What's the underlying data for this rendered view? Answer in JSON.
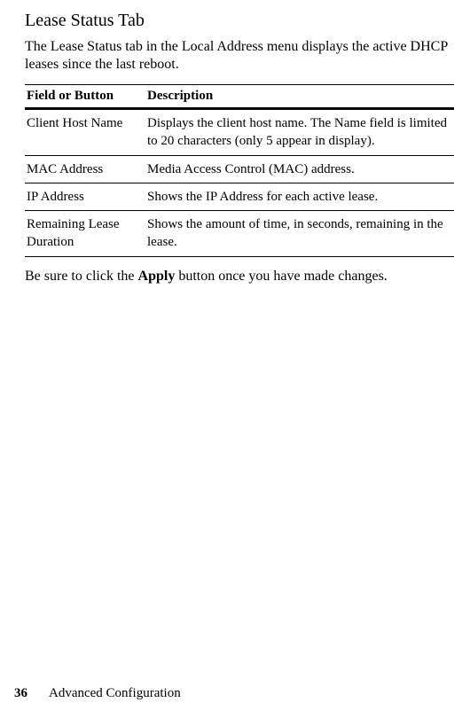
{
  "section": {
    "title": "Lease Status Tab",
    "intro": "The Lease Status tab in the Local Address menu displays the active DHCP leases since the last reboot."
  },
  "table": {
    "headers": {
      "field": "Field or Button",
      "description": "Description"
    },
    "rows": [
      {
        "field": "Client Host Name",
        "description": "Displays the client host name. The Name field is limited to 20 characters (only 5 appear in display)."
      },
      {
        "field": "MAC Address",
        "description": "Media Access Control (MAC) address."
      },
      {
        "field": "IP Address",
        "description": "Shows the IP Address for each active lease."
      },
      {
        "field": "Remaining Lease Duration",
        "description": "Shows the amount of time, in seconds, remaining in the lease."
      }
    ]
  },
  "outro": {
    "prefix": "Be sure to click the ",
    "bold": "Apply",
    "suffix": " button once you have made changes."
  },
  "footer": {
    "page": "36",
    "chapter": "Advanced Configuration"
  }
}
